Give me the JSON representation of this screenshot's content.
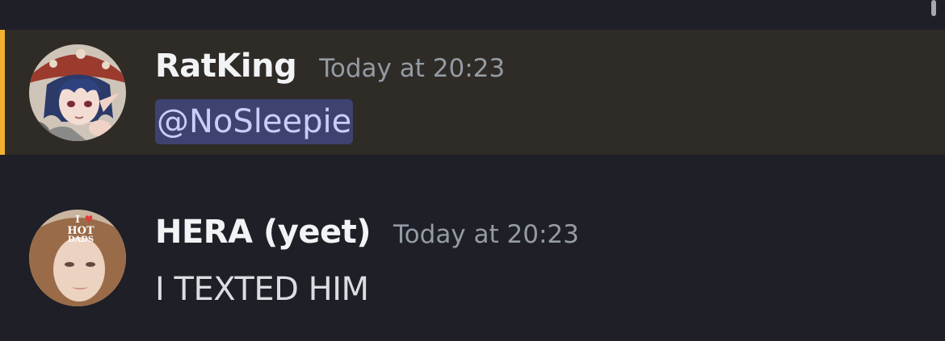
{
  "colors": {
    "background": "#1e1f27",
    "highlight_background": "#2f2b27",
    "mention_bar": "#f0b232",
    "mention_background": "#3e4270",
    "mention_text": "#c9cdfb",
    "username": "#f2f3f5",
    "timestamp": "#949ba4",
    "message_text": "#dbdee1"
  },
  "messages": [
    {
      "username": "RatKing",
      "timestamp": "Today at 20:23",
      "mention": "@NoSleepie",
      "avatar_icon": "anime-character-avatar"
    },
    {
      "username": "HERA (yeet)",
      "timestamp": "Today at 20:23",
      "text": "I TEXTED HIM",
      "avatar_icon": "selfie-avatar",
      "avatar_badge": {
        "line1": "I",
        "heart": "♥",
        "line2": "HOT",
        "line3": "DADS"
      }
    }
  ]
}
